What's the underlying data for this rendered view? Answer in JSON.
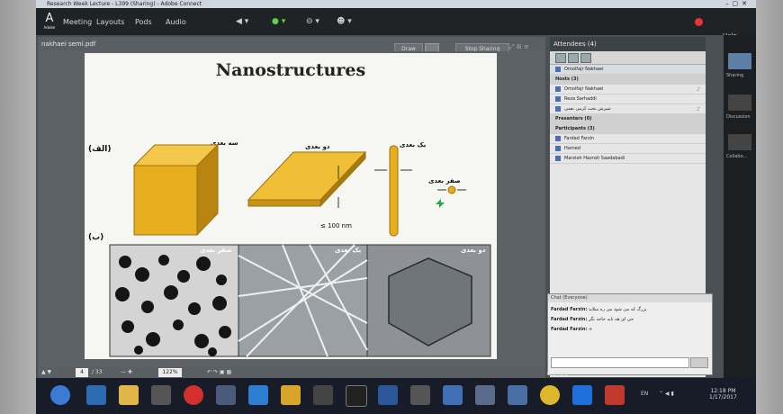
{
  "window": {
    "title": "Research Week Lecture - L399 (Sharing) - Adobe Connect"
  },
  "menu": {
    "logo": "Adobe",
    "items": [
      "Meeting",
      "Layouts",
      "Pods",
      "Audio"
    ],
    "help": "Help"
  },
  "share_pod": {
    "filename": "nakhaei semi.pdf",
    "draw_label": "Draw",
    "stop_label": "Stop Sharing",
    "page_current": "4",
    "page_total": "/ 33",
    "zoom": "122%"
  },
  "slide": {
    "title": "Nanostructures",
    "label_a": "(الف)",
    "label_b": "(ب)",
    "dim3": "سه بعدی",
    "dim2": "دو بعدی",
    "dim1": "یک بعدی",
    "dim0": "صفر بعدی",
    "nm": "≤ 100 nm",
    "img_zero": "صفر بعدی",
    "img_one": "یک بعدی",
    "img_two": "دو بعدی"
  },
  "attendees": {
    "header": "Attendees",
    "count": "(4)",
    "me": "Omolfajr Nakhaei",
    "hosts_label": "Hosts (3)",
    "hosts": [
      "Omolfajr Nakhaei",
      "Reza Sarhaddi",
      "شیرش نخت کرمی تعمی"
    ],
    "presenters_label": "Presenters (0)",
    "participants_label": "Participants (3)",
    "participants": [
      "Fardad Farzin",
      "Hamed",
      "Marzieh Hazrati Saadabadi"
    ]
  },
  "chat": {
    "header": "Chat",
    "scope": "(Everyone)",
    "messages": [
      {
        "from": "Fardad Farzin:",
        "text": "بزرگ که می شود می ره سلایه"
      },
      {
        "from": "Fardad Farzin:",
        "text": "حی ای هه تایه حاجه نگر"
      },
      {
        "from": "Fardad Farzin:",
        "text": "+"
      }
    ],
    "recipient": "Everyone"
  },
  "rail": {
    "items": [
      "Sharing",
      "Discussion",
      "Collabo..."
    ]
  },
  "taskbar": {
    "lang": "EN",
    "time": "12:18 PM",
    "date": "1/17/2017"
  },
  "colors": {
    "accent": "#e0a91f",
    "menubar": "#1f2326",
    "attendee_panel": "#e6e6e6"
  }
}
